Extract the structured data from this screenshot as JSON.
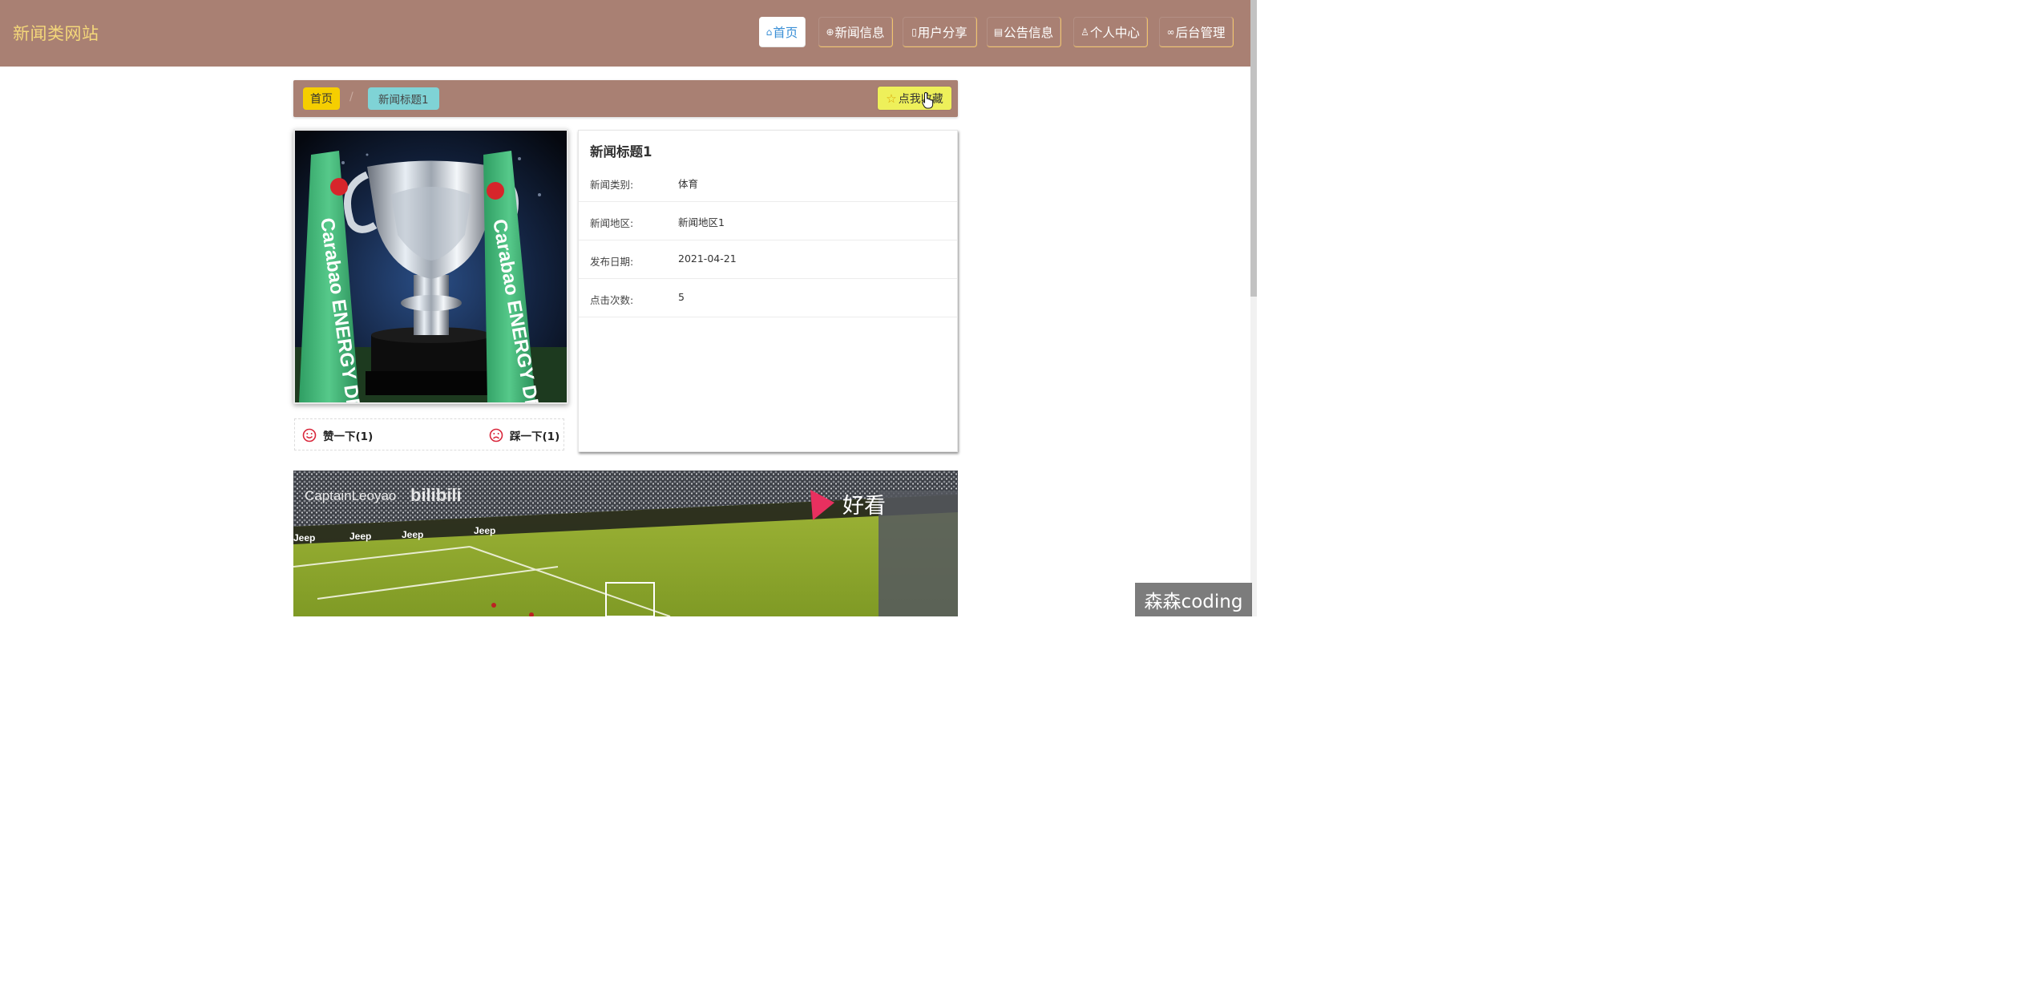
{
  "header": {
    "site_title": "新闻类网站",
    "nav": [
      {
        "icon": "home-icon",
        "label": "首页",
        "active": true
      },
      {
        "icon": "globe-icon",
        "label": "新闻信息"
      },
      {
        "icon": "share-icon",
        "label": "用户分享"
      },
      {
        "icon": "notice-icon",
        "label": "公告信息"
      },
      {
        "icon": "user-icon",
        "label": "个人中心"
      },
      {
        "icon": "link-icon",
        "label": "后台管理"
      }
    ]
  },
  "breadcrumb": {
    "home": "首页",
    "current": "新闻标题1",
    "favorite_label": "点我收藏"
  },
  "news": {
    "title": "新闻标题1",
    "fields": [
      {
        "label": "新闻类别:",
        "value": "体育"
      },
      {
        "label": "新闻地区:",
        "value": "新闻地区1"
      },
      {
        "label": "发布日期:",
        "value": "2021-04-21"
      },
      {
        "label": "点击次数:",
        "value": "5"
      }
    ],
    "image_ribbon_text": "Carabao ENERGY DR",
    "like_label": "赞一下(1)",
    "dislike_label": "踩一下(1)"
  },
  "video": {
    "channel_text": "CaptainLeoyao",
    "platform_text": "bilibili",
    "logo_text": "好看",
    "banner_text": "Jeep"
  },
  "watermark": "森森coding",
  "colors": {
    "header_bg": "#a98073",
    "site_title": "#f4d77a",
    "home_tag": "#f5ce00",
    "current_tag": "#7fd3d6",
    "favorite_btn": "#eef05a",
    "vote_icon": "#d9263b"
  }
}
